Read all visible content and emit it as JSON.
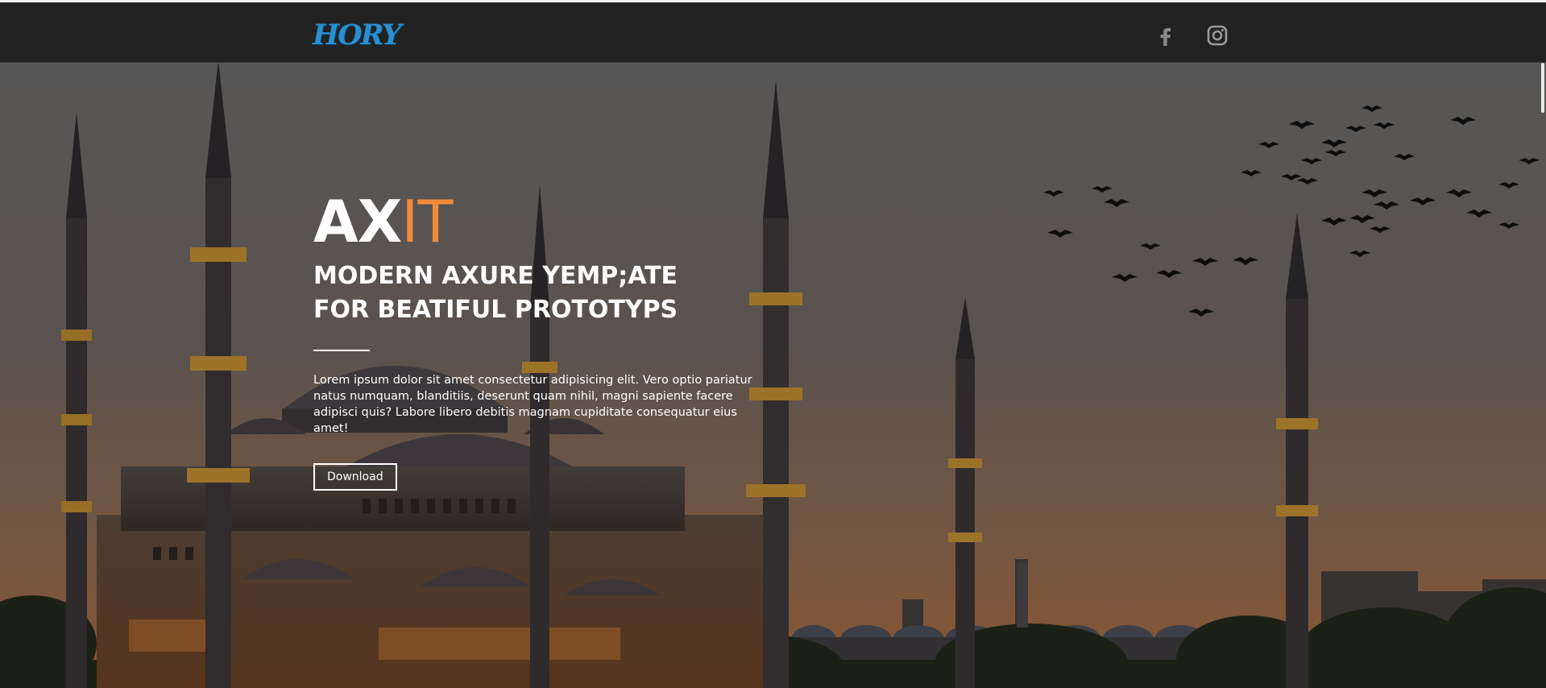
{
  "brand": {
    "logo_text": "HORY",
    "logo_sub": "",
    "accent_color": "#f08a3a"
  },
  "nav": {
    "social": [
      {
        "icon": "facebook-icon"
      },
      {
        "icon": "instagram-icon"
      }
    ]
  },
  "hero": {
    "headline_main": "AX",
    "headline_accent": "IT",
    "subtitle": "MODERN AXURE YEMP;ATE FOR BEATIFUL PROTOTYPS",
    "body": "Lorem ipsum dolor sit amet consectetur adipisicing elit. Vero optio pariatur natus numquam, blanditiis, deserunt quam nihil, magni sapiente facere adipisci quis? Labore libero debitis magnam cupiditate consequatur eius amet!",
    "cta_label": "Download",
    "background": "mosque-at-dusk-with-birds"
  }
}
